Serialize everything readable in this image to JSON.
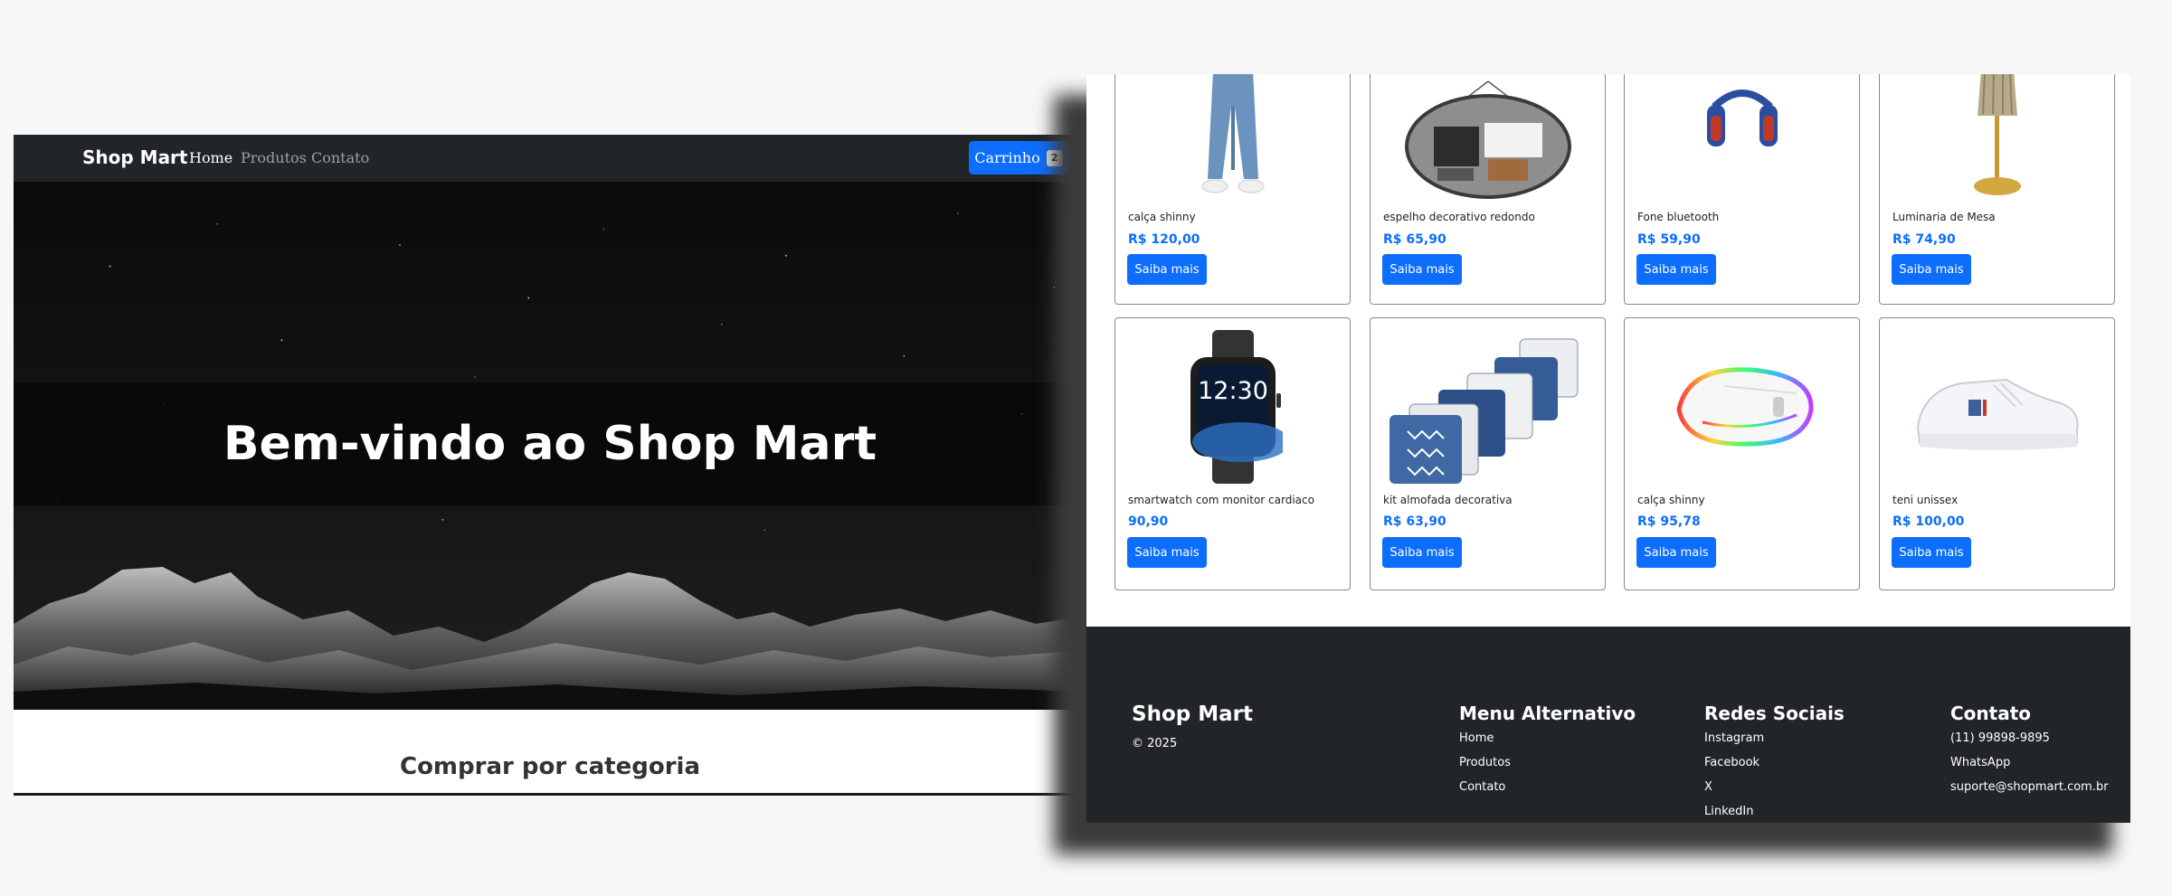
{
  "navbar": {
    "brand": "Shop Mart",
    "links": [
      "Home",
      "Produtos",
      "Contato"
    ],
    "cart_label": "Carrinho",
    "cart_count": "2"
  },
  "hero": {
    "title": "Bem-vindo ao Shop Mart"
  },
  "categories": {
    "title": "Comprar por categoria"
  },
  "products": [
    {
      "name": "calça shinny",
      "price": "R$ 120,00",
      "button": "Saiba mais",
      "icon": "jeans-icon"
    },
    {
      "name": "espelho decorativo redondo",
      "price": "R$ 65,90",
      "button": "Saiba mais",
      "icon": "mirror-icon"
    },
    {
      "name": "Fone bluetooth",
      "price": "R$ 59,90",
      "button": "Saiba mais",
      "icon": "headphones-icon"
    },
    {
      "name": "Luminaria de Mesa",
      "price": "R$ 74,90",
      "button": "Saiba mais",
      "icon": "lamp-icon"
    },
    {
      "name": "smartwatch com monitor cardiaco",
      "price": "90,90",
      "button": "Saiba mais",
      "icon": "smartwatch-icon",
      "screen_text": "12:30"
    },
    {
      "name": "kit almofada decorativa",
      "price": "R$ 63,90",
      "button": "Saiba mais",
      "icon": "pillows-icon"
    },
    {
      "name": "calça shinny",
      "price": "R$ 95,78",
      "button": "Saiba mais",
      "icon": "mouse-icon"
    },
    {
      "name": "teni unissex",
      "price": "R$ 100,00",
      "button": "Saiba mais",
      "icon": "sneaker-icon"
    }
  ],
  "footer": {
    "brand": "Shop Mart",
    "copyright": "© 2025",
    "menu": {
      "title": "Menu Alternativo",
      "items": [
        "Home",
        "Produtos",
        "Contato"
      ]
    },
    "social": {
      "title": "Redes Sociais",
      "items": [
        "Instagram",
        "Facebook",
        "X",
        "LinkedIn"
      ]
    },
    "contact": {
      "title": "Contato",
      "items": [
        "(11) 99898-9895",
        "WhatsApp",
        "suporte@shopmart.com.br"
      ]
    }
  },
  "colors": {
    "primary": "#0d6efd",
    "dark": "#212529",
    "page_bg": "#f7f7f8"
  }
}
